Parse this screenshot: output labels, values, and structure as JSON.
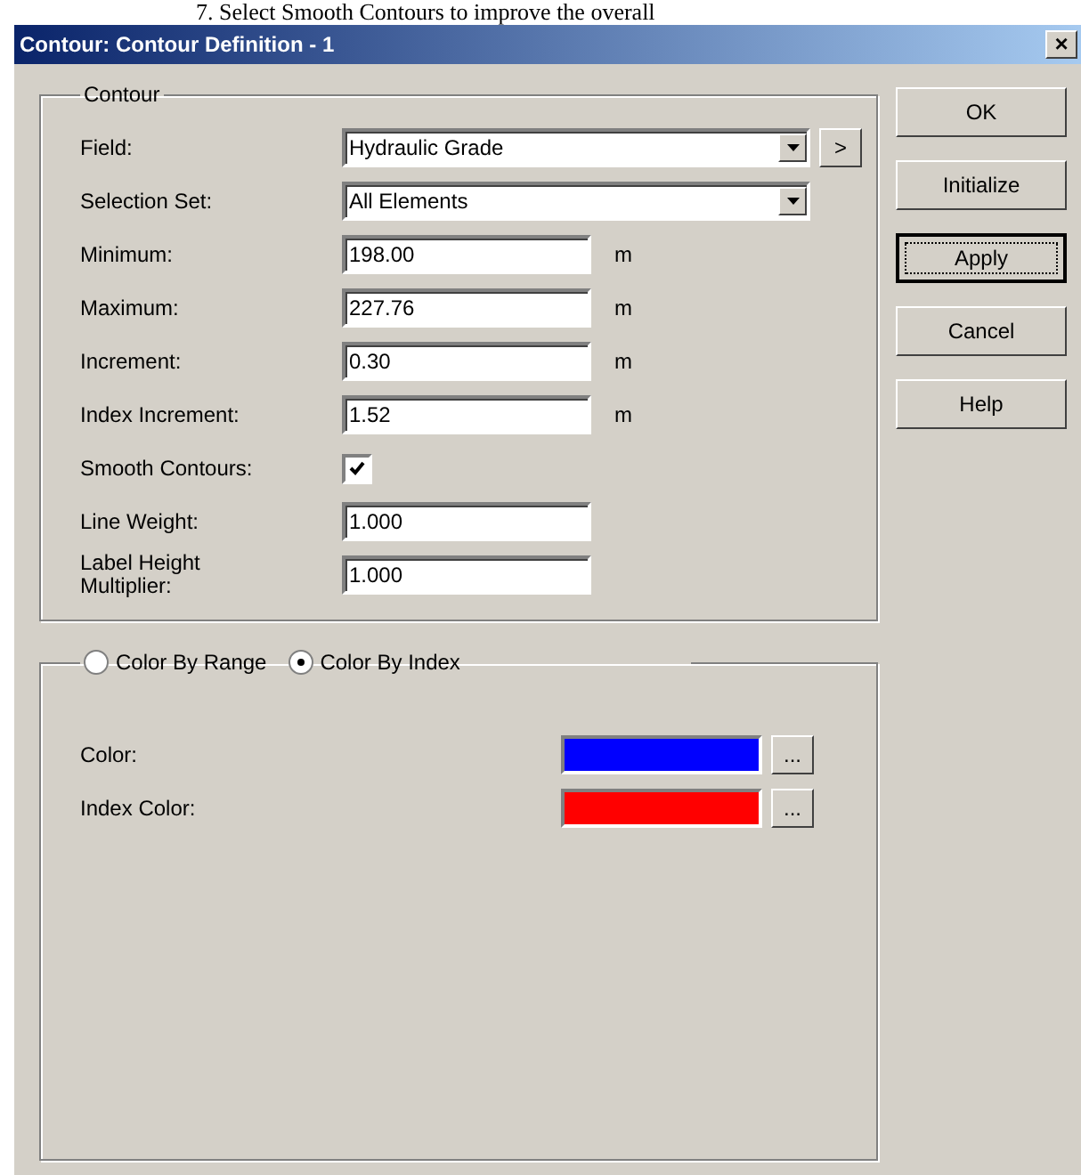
{
  "document_text": "7.   Select Smooth Contours to improve the overall",
  "window": {
    "title": "Contour: Contour Definition - 1",
    "close": "×"
  },
  "contour_group": {
    "title": "Contour",
    "rows": [
      {
        "kind": "dropdown",
        "label": "Field:",
        "value": "Hydraulic Grade",
        "arrow_button": ">"
      },
      {
        "kind": "dropdown",
        "label": "Selection Set:",
        "value": "All Elements"
      },
      {
        "kind": "text",
        "label": "Minimum:",
        "value": "198.00",
        "unit": "m"
      },
      {
        "kind": "text",
        "label": "Maximum:",
        "value": "227.76",
        "unit": "m"
      },
      {
        "kind": "text",
        "label": "Increment:",
        "value": "0.30",
        "unit": "m"
      },
      {
        "kind": "text",
        "label": "Index Increment:",
        "value": "1.52",
        "unit": "m"
      },
      {
        "kind": "checkbox",
        "label": "Smooth Contours:",
        "checked": true
      },
      {
        "kind": "text",
        "label": "Line Weight:",
        "value": "1.000"
      },
      {
        "kind": "text",
        "label": "Label Height Multiplier:",
        "value": "1.000"
      }
    ]
  },
  "color_group": {
    "modes": [
      {
        "label": "Color By Range",
        "selected": false
      },
      {
        "label": "Color By Index",
        "selected": true
      }
    ],
    "colors": [
      {
        "label": "Color:",
        "color": "#0000ff",
        "button": "..."
      },
      {
        "label": "Index Color:",
        "color": "#ff0000",
        "button": "..."
      }
    ]
  },
  "buttons": [
    {
      "label": "OK",
      "focused": false
    },
    {
      "label": "Initialize",
      "focused": false
    },
    {
      "label": "Apply",
      "focused": true
    },
    {
      "label": "Cancel",
      "focused": false
    },
    {
      "label": "Help",
      "focused": false
    }
  ]
}
